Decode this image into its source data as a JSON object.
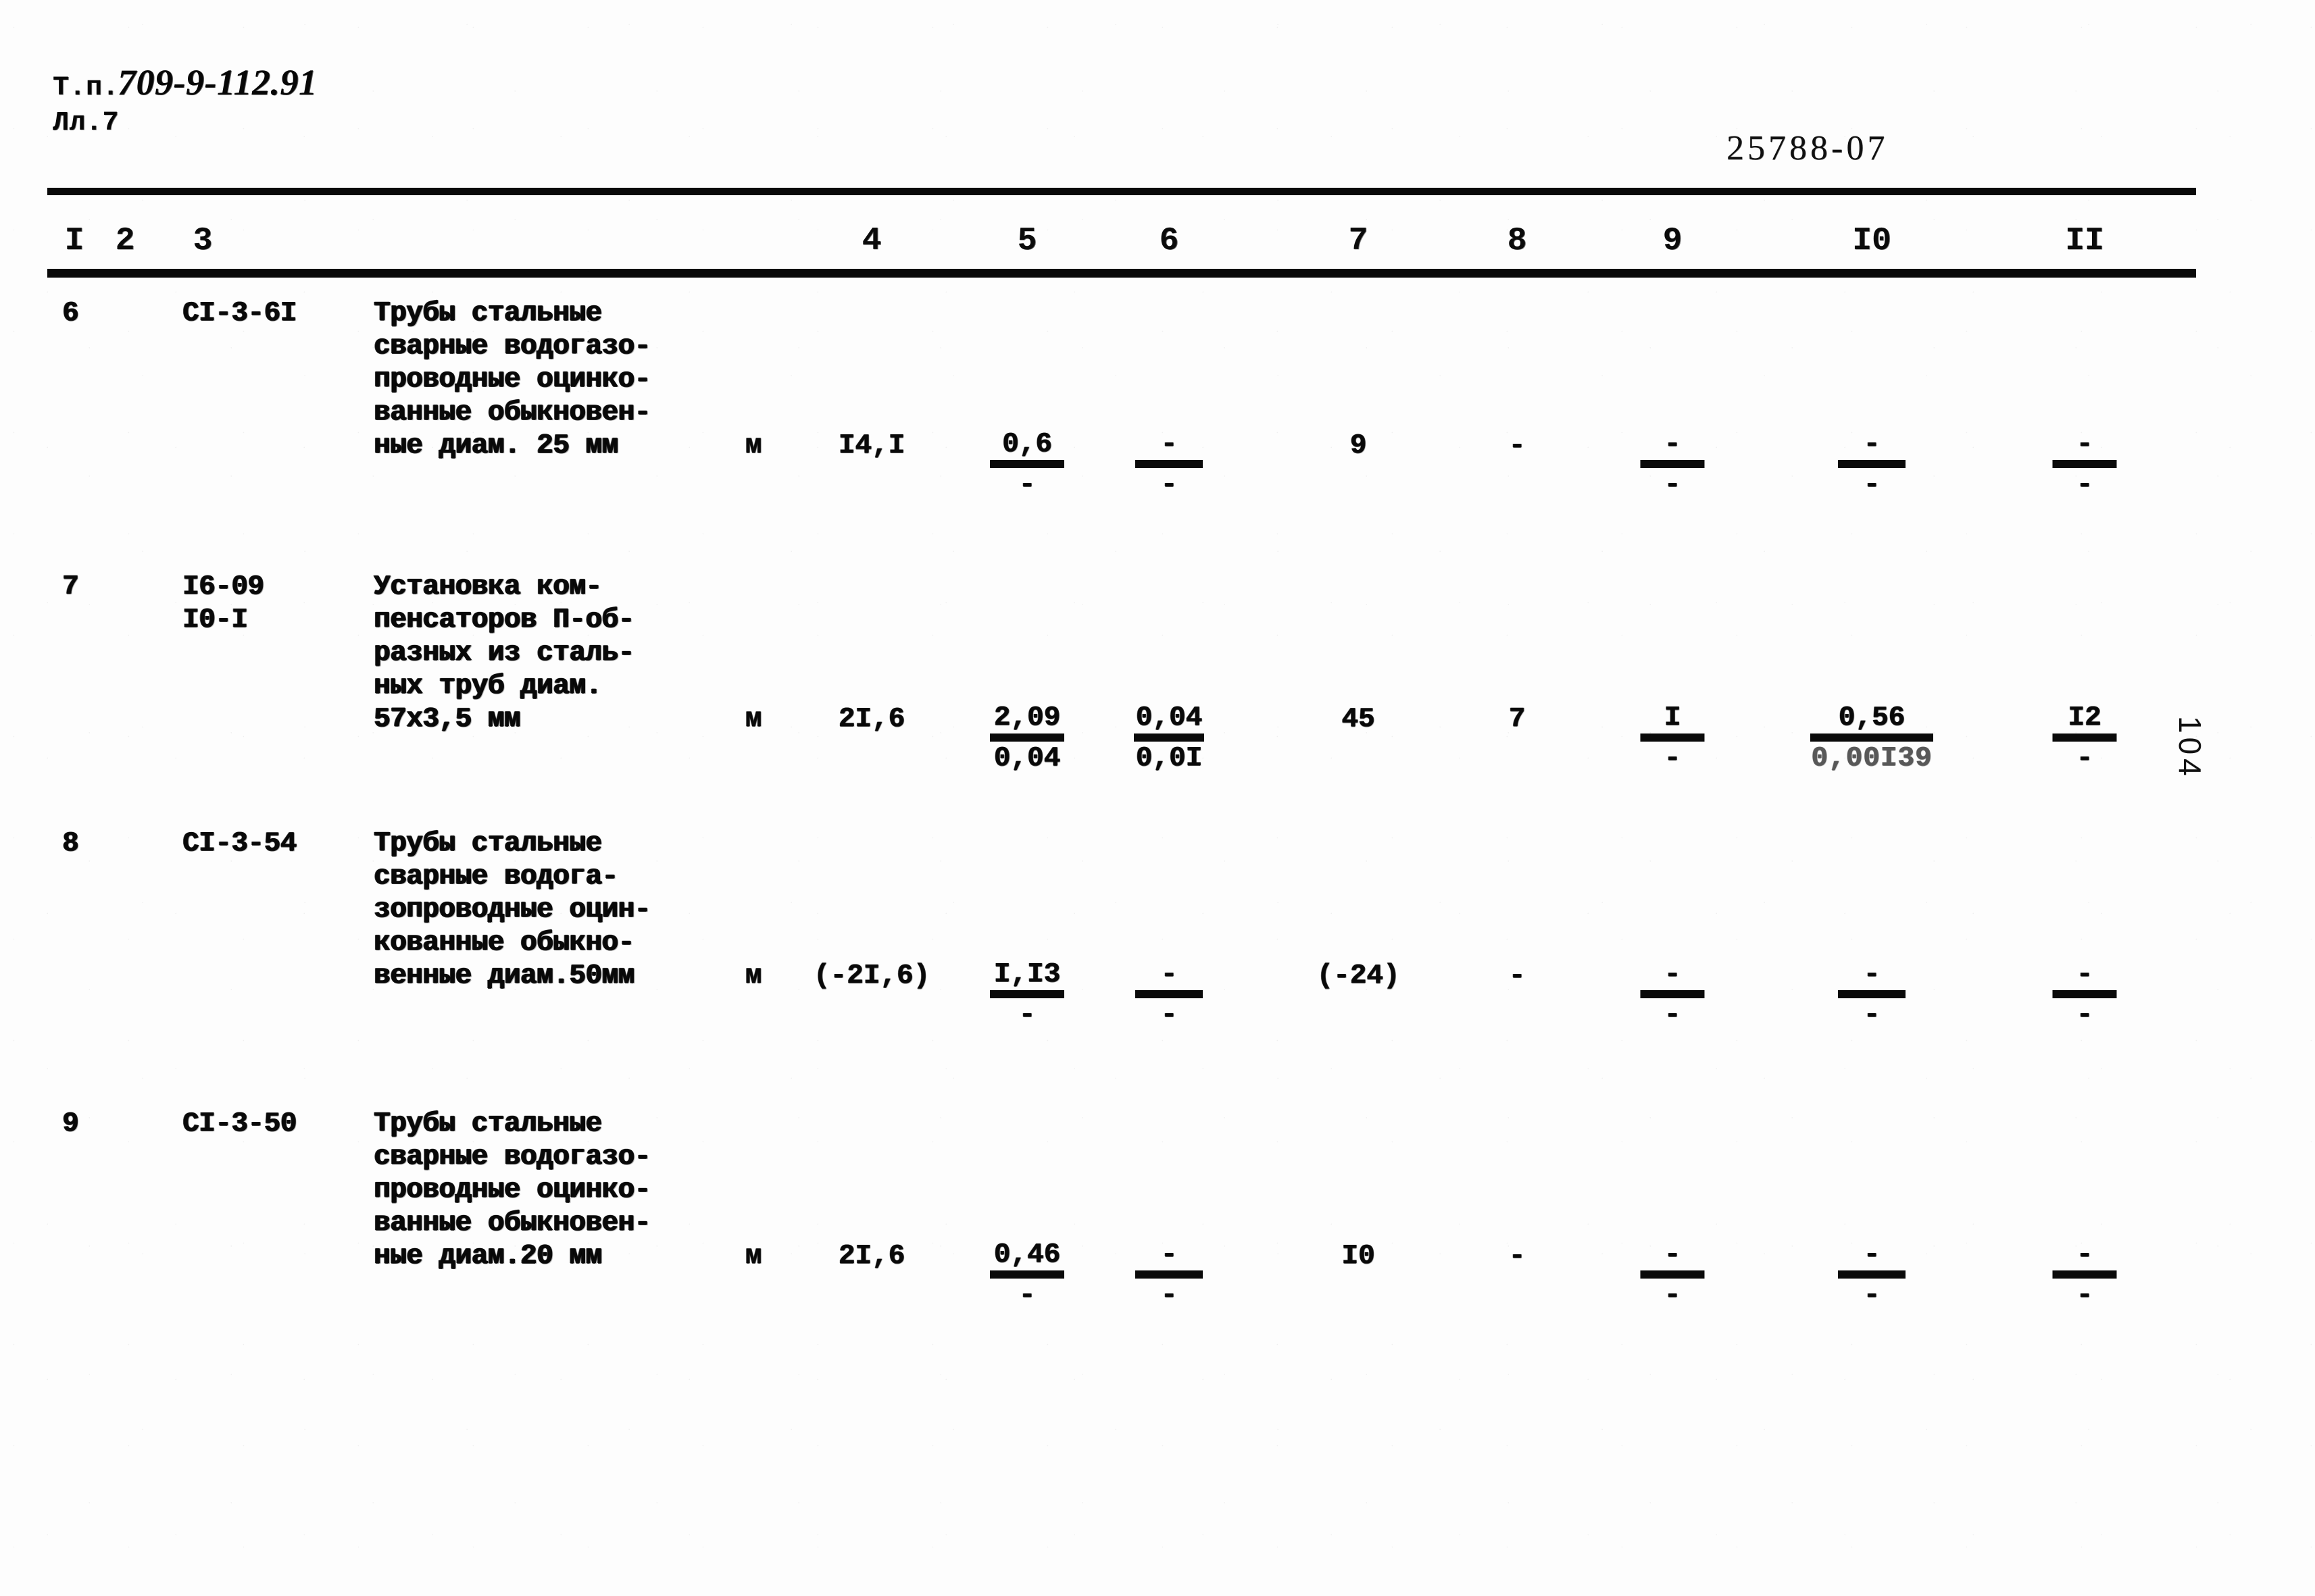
{
  "header": {
    "doc_label_line1": "Т.п.",
    "doc_label_line2": "Лл.7",
    "doc_number": "709-9-112.91",
    "stamp_number": "25788-07",
    "folio": "104"
  },
  "table": {
    "column_numbers": [
      "I",
      "2",
      "3",
      "4",
      "5",
      "6",
      "7",
      "8",
      "9",
      "I0",
      "II"
    ],
    "rows": [
      {
        "num": "6",
        "code": "CI-3-6I",
        "description_lines": [
          "Трубы стальные",
          "сварные водогазо-",
          "проводные оцинко-",
          "ванные обыкновен-",
          "ные диам. 25 мм"
        ],
        "unit": "м",
        "c4": "I4,I",
        "c5_top": "0,6",
        "c5_bot": "-",
        "c6_top": "-",
        "c6_bot": "-",
        "c7": "9",
        "c8": "-",
        "c9_top": "-",
        "c9_bot": "-",
        "c10_top": "-",
        "c10_bot": "-",
        "c11_top": "-",
        "c11_bot": "-"
      },
      {
        "num": "7",
        "code": "I6-09",
        "code2": "I0-I",
        "description_lines": [
          "Установка ком-",
          "пенсаторов П-об-",
          "разных из сталь-",
          "ных труб диам.",
          "57х3,5 мм"
        ],
        "unit": "м",
        "c4": "2I,6",
        "c5_top": "2,09",
        "c5_bot": "0,04",
        "c6_top": "0,04",
        "c6_bot": "0,0I",
        "c7": "45",
        "c8": "7",
        "c9_top": "I",
        "c9_bot": "-",
        "c10_top": "0,56",
        "c10_bot": "0,00I39",
        "c11_top": "I2",
        "c11_bot": "-"
      },
      {
        "num": "8",
        "code": "CI-3-54",
        "description_lines": [
          "Трубы стальные",
          "сварные водога-",
          "зопроводные оцин-",
          "кованные обыкно-",
          "венные диам.50мм"
        ],
        "unit": "м",
        "c4": "(-2I,6)",
        "c5_top": "I,I3",
        "c5_bot": "-",
        "c6_top": "-",
        "c6_bot": "-",
        "c7": "(-24)",
        "c8": "-",
        "c9_top": "-",
        "c9_bot": "-",
        "c10_top": "-",
        "c10_bot": "-",
        "c11_top": "-",
        "c11_bot": "-"
      },
      {
        "num": "9",
        "code": "CI-3-50",
        "description_lines": [
          "Трубы стальные",
          "сварные водогазо-",
          "проводные оцинко-",
          "ванные обыкновен-",
          "ные диам.20 мм"
        ],
        "unit": "м",
        "c4": "2I,6",
        "c5_top": "0,46",
        "c5_bot": "-",
        "c6_top": "-",
        "c6_bot": "-",
        "c7": "I0",
        "c8": "-",
        "c9_top": "-",
        "c9_bot": "-",
        "c10_top": "-",
        "c10_bot": "-",
        "c11_top": "-",
        "c11_bot": "-"
      }
    ]
  },
  "layout": {
    "column_x": [
      110,
      185,
      300,
      1290,
      1520,
      1730,
      2010,
      2245,
      2475,
      2770,
      3085
    ],
    "row_top": [
      440,
      845,
      1225,
      1640
    ]
  }
}
